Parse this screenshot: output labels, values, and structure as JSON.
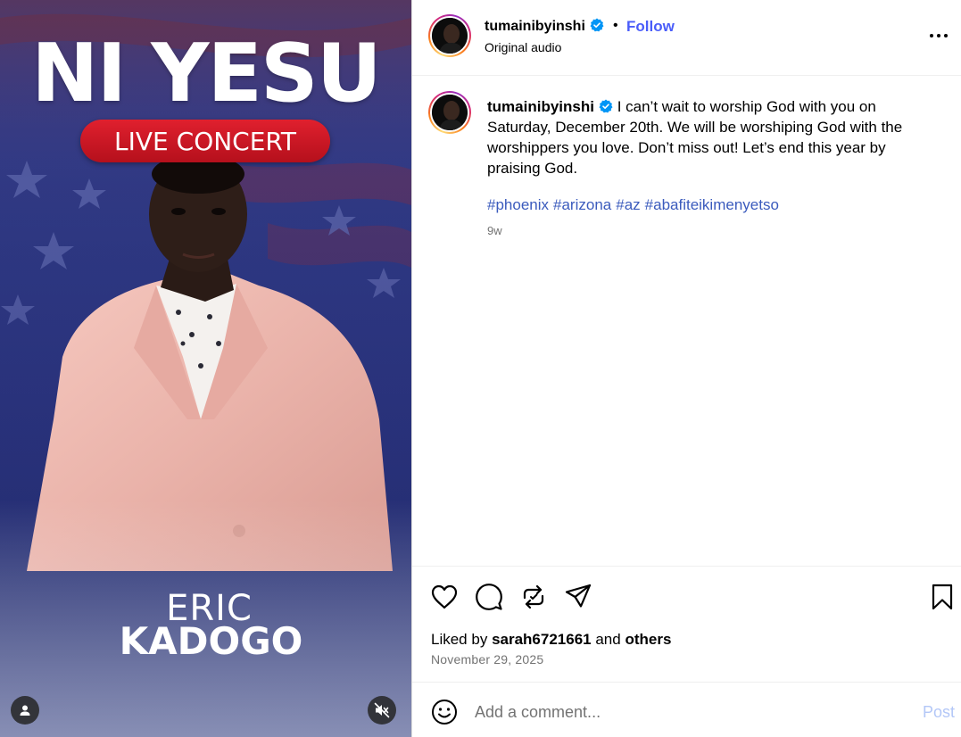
{
  "media": {
    "title": "NI YESU",
    "subtitle": "LIVE CONCERT",
    "artist_first": "ERIC",
    "artist_last": "KADOGO",
    "muted": true
  },
  "header": {
    "username": "tumainibyinshi",
    "verified": true,
    "separator": "•",
    "follow_label": "Follow",
    "audio_label": "Original audio"
  },
  "caption": {
    "username": "tumainibyinshi",
    "text": "I can’t wait to worship God with you on Saturday, December 20th. We will be worshiping God with the worshippers you love. Don’t miss out! Let’s end this year by praising God.",
    "hashtags": [
      "#phoenix",
      "#arizona",
      "#az",
      "#abafiteikimenyetso"
    ],
    "time_ago": "9w"
  },
  "actions": {
    "liked_prefix": "Liked by",
    "liked_user": "sarah6721661",
    "liked_and": "and",
    "liked_others": "others",
    "date": "November 29, 2025"
  },
  "comment": {
    "placeholder": "Add a comment...",
    "post_label": "Post"
  },
  "colors": {
    "link_blue": "#4a5df9",
    "hashtag_blue": "#3b5bbd",
    "muted_gray": "#737373",
    "post_disabled": "#b3c7f7"
  }
}
